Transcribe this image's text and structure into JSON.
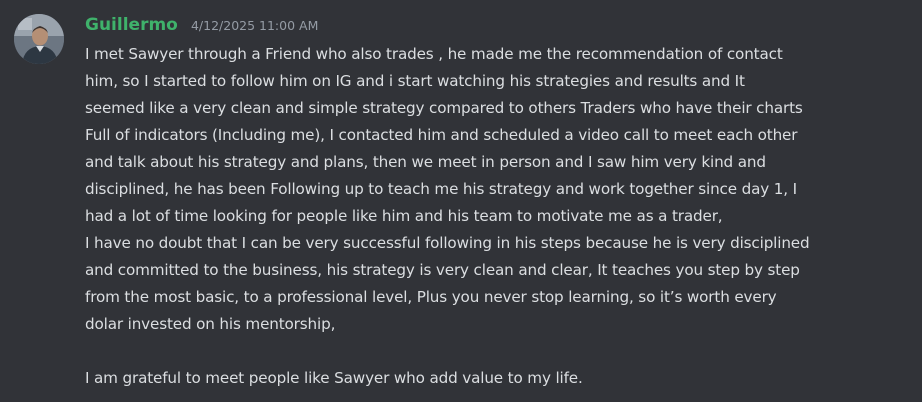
{
  "message": {
    "username": "Guillermo",
    "timestamp": "4/12/2025 11:00 AM",
    "username_color": "#3fb26b",
    "lines": [
      "I met Sawyer through a Friend who also trades , he made me the recommendation of contact",
      "him, so I started to follow him on IG and i start watching his strategies and results and It",
      "seemed like a very clean and simple strategy compared to others Traders who have their charts",
      "Full of indicators (Including me), I contacted him and scheduled a video call to meet each other",
      "and talk about his strategy and plans, then we meet in person and I saw him very kind and",
      "disciplined, he has been Following up to teach me his strategy and work together since day 1, I",
      "had a lot of time looking for people like him and his team to motivate me as a trader,",
      "I have no doubt that I can be very successful following in his steps because he is very disciplined",
      "and committed to the business, his strategy is very clean and clear,  It teaches you step by step",
      "from the most basic, to a professional level, Plus you never stop learning, so it’s worth every",
      "dolar invested on his mentorship,",
      "I am grateful to meet people like Sawyer who add value to my life."
    ]
  },
  "colors": {
    "background": "#313338",
    "text": "#dbdee1",
    "timestamp": "#949ba4"
  }
}
